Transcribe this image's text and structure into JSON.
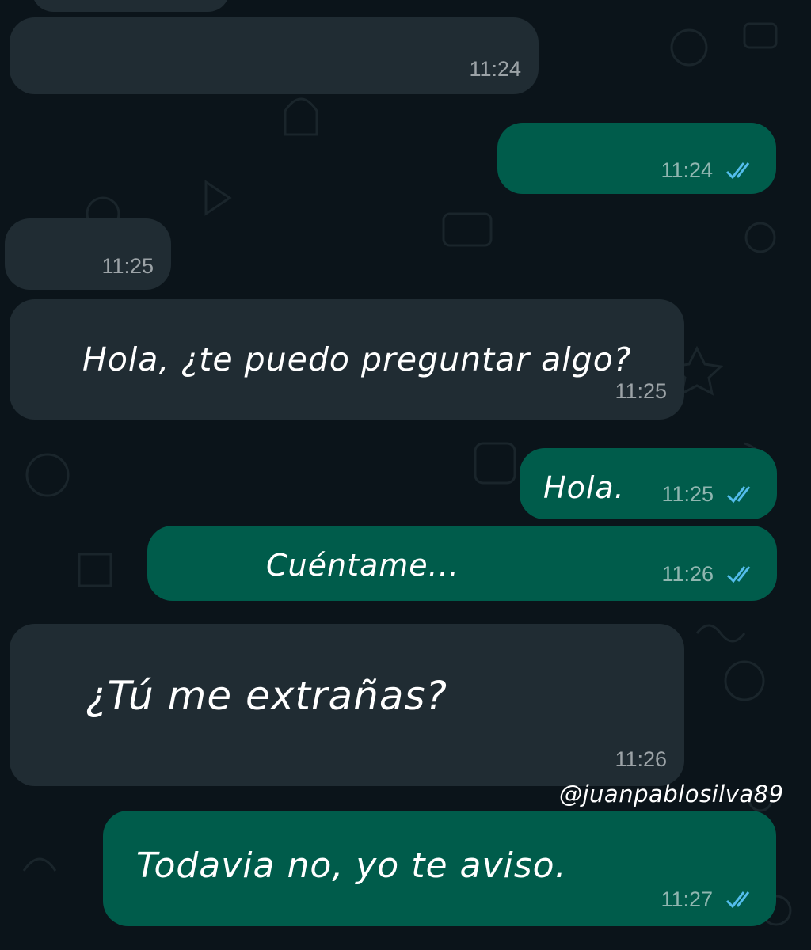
{
  "messages": [
    {
      "direction": "incoming",
      "text": "",
      "time": "11:24"
    },
    {
      "direction": "outgoing",
      "text": "",
      "time": "11:24",
      "status": "read"
    },
    {
      "direction": "incoming",
      "text": "",
      "time": "11:25"
    },
    {
      "direction": "incoming",
      "text": "Hola, ¿te puedo preguntar algo?",
      "time": "11:25"
    },
    {
      "direction": "outgoing",
      "text": "Hola.",
      "time": "11:25",
      "status": "read"
    },
    {
      "direction": "outgoing",
      "text": "Cuéntame...",
      "time": "11:26",
      "status": "read"
    },
    {
      "direction": "incoming",
      "text": "¿Tú me extrañas?",
      "time": "11:26"
    },
    {
      "direction": "outgoing",
      "text": "Todavia no, yo te aviso.",
      "time": "11:27",
      "status": "read"
    }
  ],
  "watermark": "@juanpablosilva89",
  "colors": {
    "background": "#0b141a",
    "incoming_bubble": "#202c33",
    "outgoing_bubble": "#005c4b",
    "read_ticks": "#53bdeb",
    "timestamp": "#8696a0"
  },
  "icons": {
    "read_receipt": "double-check-icon"
  }
}
